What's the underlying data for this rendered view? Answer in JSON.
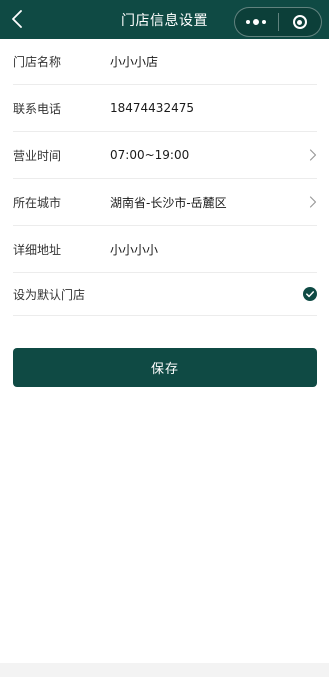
{
  "header": {
    "title": "门店信息设置",
    "back_icon": "chevron-left-icon",
    "more_icon": "more-dots-icon",
    "close_icon": "target-close-icon",
    "background_color": "#0f4a44"
  },
  "form": {
    "rows": [
      {
        "label": "门店名称",
        "value": "小小小店"
      },
      {
        "label": "联系电话",
        "value": "18474432475"
      },
      {
        "label": "营业时间",
        "value": "07:00~19:00"
      },
      {
        "label": "所在城市",
        "value": "湖南省-长沙市-岳麓区"
      },
      {
        "label": "详细地址",
        "value": "小小小小"
      },
      {
        "label": "设为默认门店",
        "value": ""
      }
    ],
    "default_store_checked": true
  },
  "save_button": {
    "label": "保存",
    "color": "#0f4a44"
  }
}
